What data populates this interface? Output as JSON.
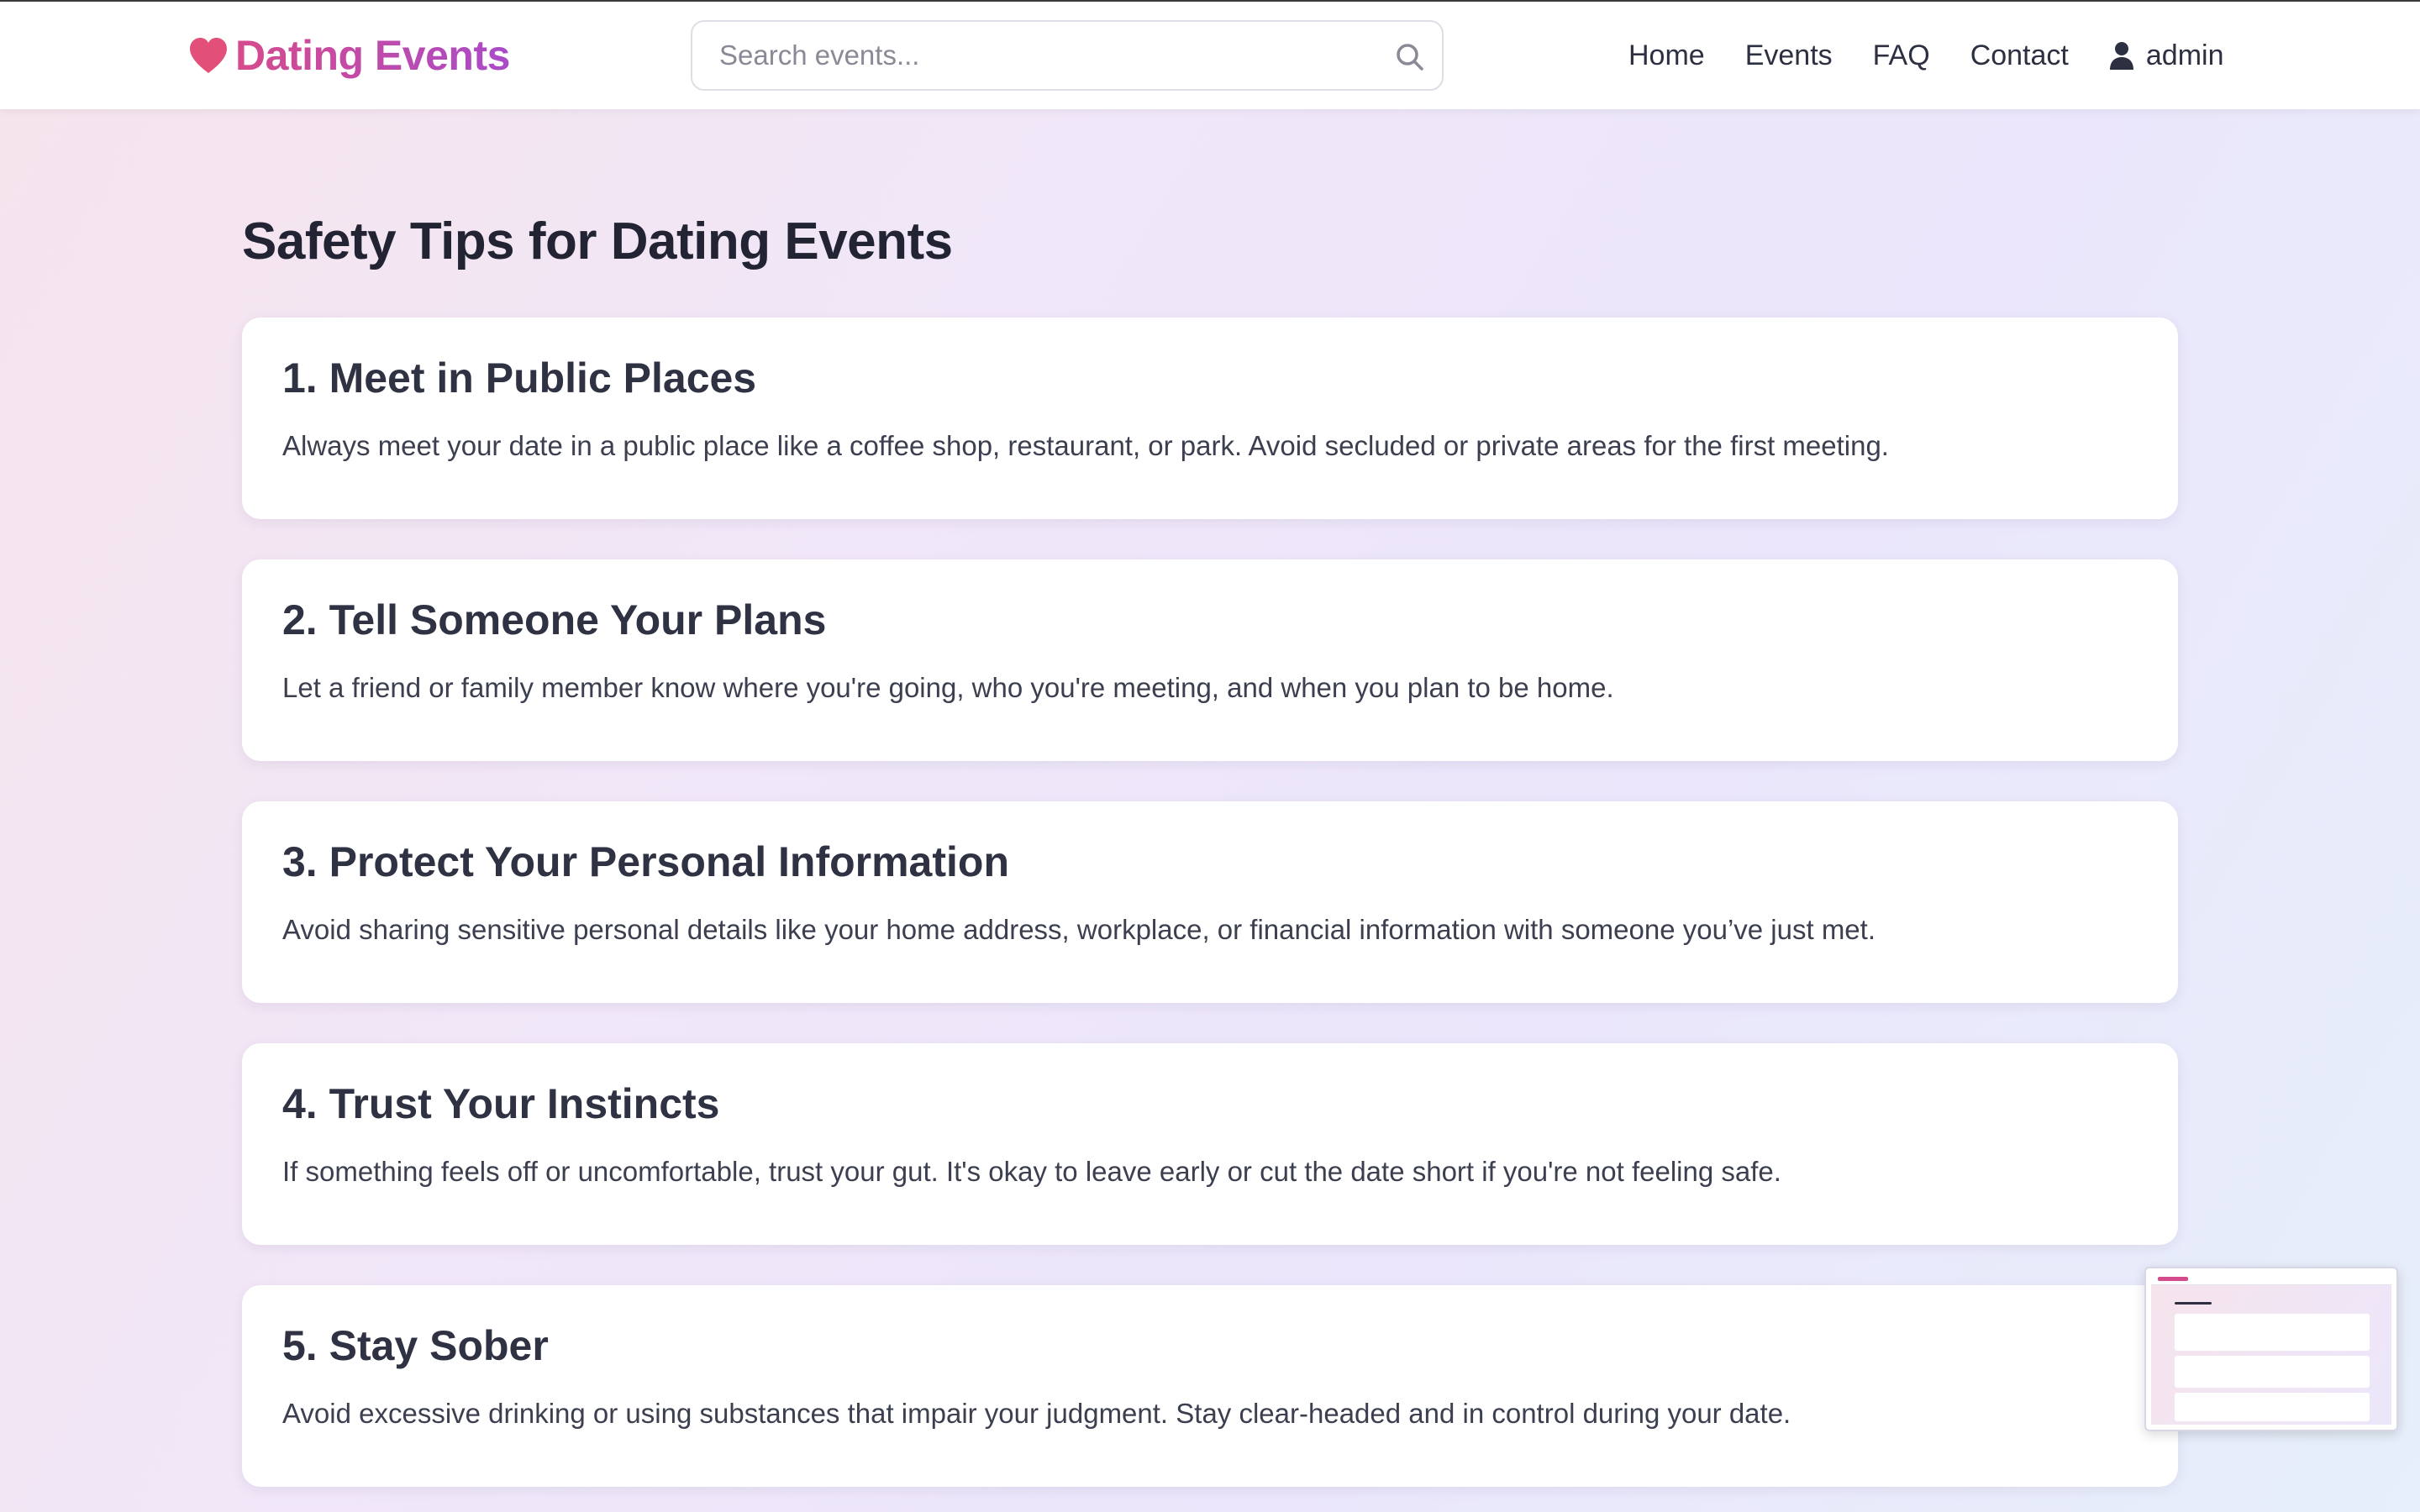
{
  "header": {
    "logo_text": "Dating Events",
    "logo_icon": "heart-icon",
    "search_placeholder": "Search events...",
    "search_icon": "search-icon",
    "nav": {
      "home": "Home",
      "events": "Events",
      "faq": "FAQ",
      "contact": "Contact"
    },
    "user_icon": "user-icon",
    "username": "admin"
  },
  "page": {
    "title": "Safety Tips for Dating Events"
  },
  "tips": [
    {
      "title": "1. Meet in Public Places",
      "text": "Always meet your date in a public place like a coffee shop, restaurant, or park. Avoid secluded or private areas for the first meeting."
    },
    {
      "title": "2. Tell Someone Your Plans",
      "text": "Let a friend or family member know where you're going, who you're meeting, and when you plan to be home."
    },
    {
      "title": "3. Protect Your Personal Information",
      "text": "Avoid sharing sensitive personal details like your home address, workplace, or financial information with someone you’ve just met."
    },
    {
      "title": "4. Trust Your Instincts",
      "text": "If something feels off or uncomfortable, trust your gut. It's okay to leave early or cut the date short if you're not feeling safe."
    },
    {
      "title": "5. Stay Sober",
      "text": "Avoid excessive drinking or using substances that impair your judgment. Stay clear-headed and in control during your date."
    }
  ],
  "colors": {
    "brand_pink": "#d64b8c",
    "brand_purple": "#a94bc8",
    "heart": "#e2507a",
    "text_dark": "#2d3040",
    "card_bg": "#ffffff"
  }
}
